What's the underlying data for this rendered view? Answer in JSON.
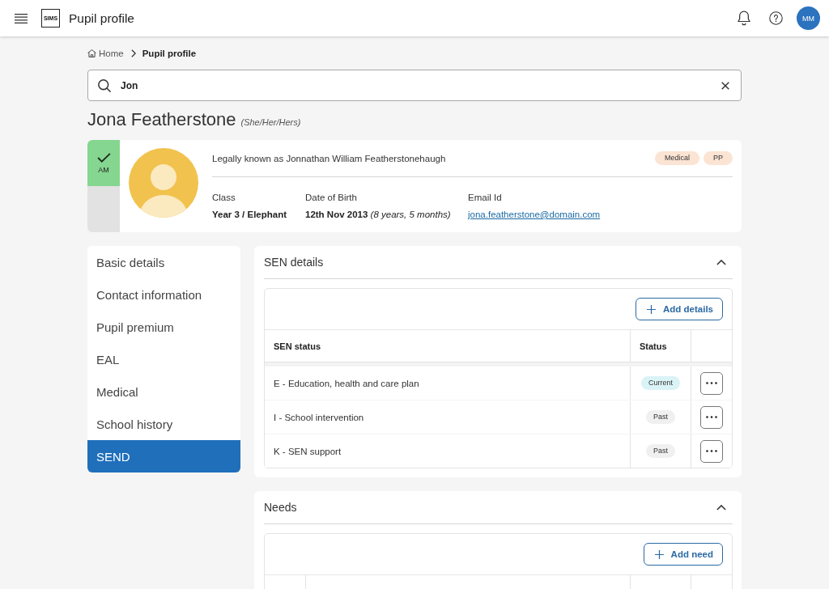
{
  "app_bar": {
    "logo": "SIMS",
    "title": "Pupil profile",
    "avatar": "MM"
  },
  "breadcrumb": [
    {
      "label": "Home",
      "kind": "home"
    },
    {
      "label": "Pupil profile",
      "kind": "current"
    }
  ],
  "search": {
    "value": "Jon"
  },
  "pupil": {
    "name": "Jona Featherstone",
    "pronouns": "(She/Her/Hers)",
    "attendance": {
      "label": "AM",
      "checked": true
    },
    "legal_name": "Legally known as Jonnathan William Featherstonehaugh",
    "tags": [
      "Medical",
      "PP"
    ],
    "fields": [
      {
        "label": "Class",
        "value": "Year 3 / Elephant",
        "kind": "text"
      },
      {
        "label": "Date of Birth",
        "value": "**12th Nov 2013** *(8 years, 5 months)*",
        "kind": "rich"
      },
      {
        "label": "Email Id",
        "value": "jona.featherstone@domain.com",
        "kind": "link"
      }
    ]
  },
  "sidebar": {
    "items": [
      {
        "label": "Basic details",
        "selected": false
      },
      {
        "label": "Contact information",
        "selected": false
      },
      {
        "label": "Pupil premium",
        "selected": false
      },
      {
        "label": "EAL",
        "selected": false
      },
      {
        "label": "Medical",
        "selected": false
      },
      {
        "label": "School history",
        "selected": false
      },
      {
        "label": "SEND",
        "selected": true
      }
    ]
  },
  "sections": [
    {
      "kind": "sen",
      "title": "SEN details",
      "expanded": true,
      "add_button": "Add details",
      "table": {
        "columns": [
          "SEN status",
          "Status"
        ],
        "rows": [
          {
            "label": "E - Education, health and care plan",
            "status": "Current",
            "color": "#daf3f7"
          },
          {
            "label": "I - School intervention",
            "status": "Past",
            "color": "#f0f0f0"
          },
          {
            "label": "K - SEN support",
            "status": "Past",
            "color": "#f0f0f0"
          }
        ]
      }
    },
    {
      "kind": "needs",
      "title": "Needs",
      "expanded": true,
      "add_button": "Add need"
    }
  ]
}
